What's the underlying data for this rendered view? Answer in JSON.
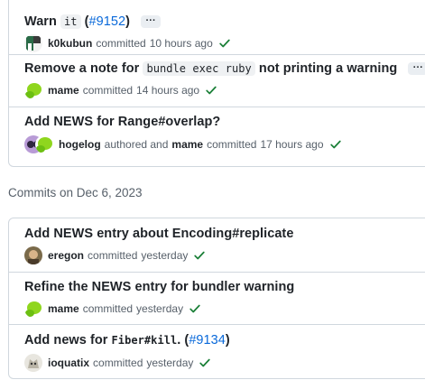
{
  "group1": {
    "commits": [
      {
        "title_pre": "Warn ",
        "code": "it",
        "title_mid": " (",
        "pr": "#9152",
        "title_post": ")",
        "ellipsis": "···",
        "author": "k0kubun",
        "verb": "committed",
        "time": "10 hours ago"
      },
      {
        "title_pre": "Remove a note for ",
        "code": "bundle exec ruby",
        "title_post": " not printing a warning",
        "ellipsis": "···",
        "author": "mame",
        "verb": "committed",
        "time": "14 hours ago"
      },
      {
        "title": "Add NEWS for Range#overlap?",
        "author": "hogelog",
        "verb": "authored and",
        "committer": "mame",
        "verb2": "committed",
        "time": "17 hours ago"
      }
    ]
  },
  "section_label": "Commits on Dec 6, 2023",
  "group2": {
    "commits": [
      {
        "title": "Add NEWS entry about Encoding#replicate",
        "author": "eregon",
        "verb": "committed",
        "time": "yesterday"
      },
      {
        "title": "Refine the NEWS entry for bundler warning",
        "author": "mame",
        "verb": "committed",
        "time": "yesterday"
      },
      {
        "title_pre": "Add news for ",
        "code": "Fiber#kill",
        "title_mid": ". (",
        "pr": "#9134",
        "title_post": ")",
        "author": "ioquatix",
        "verb": "committed",
        "time": "yesterday"
      }
    ]
  },
  "colors": {
    "link": "#0969da",
    "check": "#1a7f37",
    "muted": "#57606a",
    "border": "#d0d7de"
  },
  "icons": {
    "status": "check-icon",
    "more": "ellipsis-icon"
  }
}
